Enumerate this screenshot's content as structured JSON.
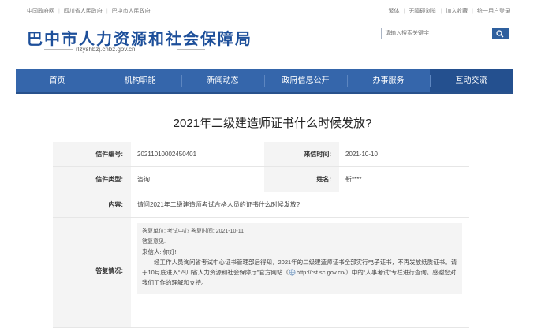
{
  "topbar": {
    "links_left": [
      "中国政府网",
      "四川省人民政府",
      "巴中市人民政府"
    ],
    "links_right": [
      "繁体",
      "无障碍浏览",
      "加入收藏",
      "统一用户登录"
    ]
  },
  "header": {
    "title": "巴中市人力资源和社会保障局",
    "domain": "rlzyshbzj.cnbz.gov.cn",
    "search_placeholder": "请输入搜索关键字"
  },
  "nav": {
    "items": [
      "首页",
      "机构职能",
      "新闻动态",
      "政府信息公开",
      "办事服务",
      "互动交流"
    ],
    "active_index": 5
  },
  "page_title": "2021年二级建造师证书什么时候发放?",
  "letter": {
    "number_label": "信件编号:",
    "number": "20211010002450401",
    "time_label": "来信时间:",
    "time": "2021-10-10",
    "type_label": "信件类型:",
    "type": "咨询",
    "name_label": "姓名:",
    "name": "靳****",
    "content_label": "内容:",
    "content": "请问2021年二级建造师考试合格人员的证书什么时候发放?",
    "reply_label": "答复情况:",
    "reply": {
      "unit_line": "答复单位:  考试中心    答复时间:  2021-10-11",
      "opinion_line": "答复意见:",
      "greeting": "来信人:  你好!",
      "body_part1": "经工作人员询问省考试中心证书管理部后得知，2021年的二级建造师证书全部实行电子证书，不再发放纸质证书。请于10月底进入“四川省人力资源和社会保障厅”官方网站（",
      "link": "http://rst.sc.gov.cn/",
      "body_part2": "）中的“人事考试”专栏进行查询。感谢您对我们工作的理解和支持。"
    }
  }
}
